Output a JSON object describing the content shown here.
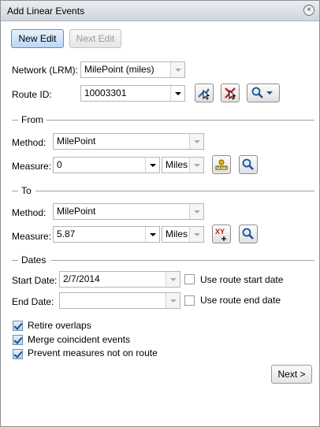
{
  "window": {
    "title": "Add Linear Events",
    "close_icon": "close-icon"
  },
  "toolbar": {
    "new_edit": "New Edit",
    "next_edit": "Next Edit"
  },
  "network": {
    "label": "Network (LRM):",
    "value": "MilePoint (miles)"
  },
  "route": {
    "label": "Route ID:",
    "value": "10003301"
  },
  "from": {
    "section": "From",
    "method_label": "Method:",
    "method_value": "MilePoint",
    "measure_label": "Measure:",
    "measure_value": "0",
    "unit": "Miles"
  },
  "to": {
    "section": "To",
    "method_label": "Method:",
    "method_value": "MilePoint",
    "measure_label": "Measure:",
    "measure_value": "5.87",
    "unit": "Miles",
    "xy_label": "XY"
  },
  "dates": {
    "section": "Dates",
    "start_label": "Start Date:",
    "start_value": "2/7/2014",
    "use_start": "Use route start date",
    "end_label": "End Date:",
    "end_value": "",
    "use_end": "Use route end date"
  },
  "options": {
    "retire": "Retire overlaps",
    "merge": "Merge coincident events",
    "prevent": "Prevent measures not on route"
  },
  "footer": {
    "next": "Next >"
  },
  "colors": {
    "accent": "#5d8fc6",
    "title_bg": "#dbe1e8"
  }
}
